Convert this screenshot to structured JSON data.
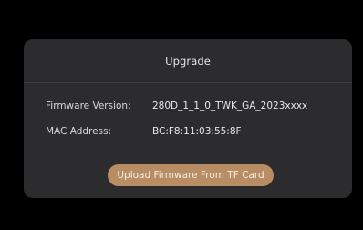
{
  "dialog": {
    "title": "Upgrade",
    "firmware_label": "Firmware Version:",
    "firmware_value": "280D_1_1_0_TWK_GA_2023xxxx",
    "mac_label": "MAC Address:",
    "mac_value": "BC:F8:11:03:55:8F",
    "upload_button_label": "Upload Firmware From TF Card"
  },
  "colors": {
    "background": "#000000",
    "dialog_background": "#2c2c2e",
    "button_accent": "#b98d63"
  }
}
